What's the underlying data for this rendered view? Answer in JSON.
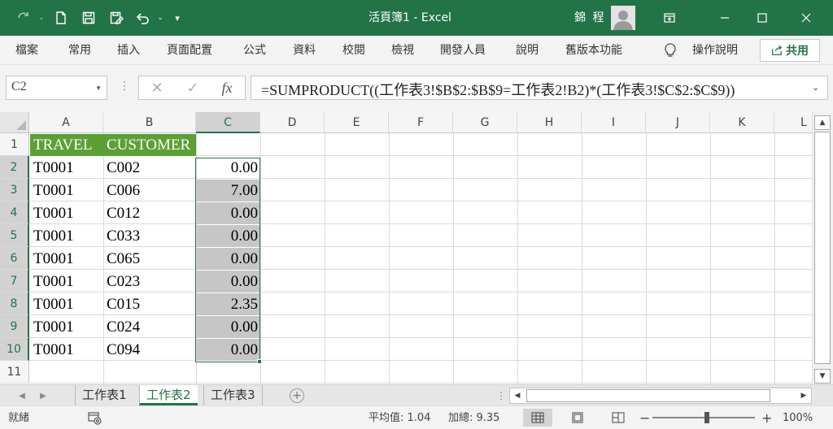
{
  "window": {
    "title": "活頁簿1  -  Excel",
    "user_name": "錦 程"
  },
  "menu": {
    "items": [
      "檔案",
      "常用",
      "插入",
      "頁面配置",
      "公式",
      "資料",
      "校閱",
      "檢視",
      "開發人員",
      "說明",
      "舊版本功能"
    ],
    "tell_me": "操作說明",
    "share": "共用"
  },
  "formula_bar": {
    "name_box": "C2",
    "fx_label": "fx",
    "formula": "=SUMPRODUCT((工作表3!$B$2:$B$9=工作表2!B2)*(工作表3!$C$2:$C$9))"
  },
  "grid": {
    "columns": [
      "A",
      "B",
      "C",
      "D",
      "E",
      "F",
      "G",
      "H",
      "I",
      "J",
      "K",
      "L"
    ],
    "selected_column": "C",
    "row_numbers": [
      "1",
      "2",
      "3",
      "4",
      "5",
      "6",
      "7",
      "8",
      "9",
      "10",
      "11"
    ],
    "header_row": [
      "TRAVEL",
      "CUSTOMER"
    ],
    "rows": [
      [
        "T0001",
        "C002",
        "0.00"
      ],
      [
        "T0001",
        "C006",
        "7.00"
      ],
      [
        "T0001",
        "C012",
        "0.00"
      ],
      [
        "T0001",
        "C033",
        "0.00"
      ],
      [
        "T0001",
        "C065",
        "0.00"
      ],
      [
        "T0001",
        "C023",
        "0.00"
      ],
      [
        "T0001",
        "C015",
        "2.35"
      ],
      [
        "T0001",
        "C024",
        "0.00"
      ],
      [
        "T0001",
        "C094",
        "0.00"
      ]
    ]
  },
  "sheets": {
    "tabs": [
      "工作表1",
      "工作表2",
      "工作表3"
    ],
    "active": "工作表2"
  },
  "status": {
    "ready": "就緒",
    "average": "平均值: 1.04",
    "sum": "加總: 9.35",
    "zoom": "100%"
  },
  "colors": {
    "accent": "#227447",
    "header_fill": "#5ba034",
    "selection_fill": "#c6c6c6"
  }
}
